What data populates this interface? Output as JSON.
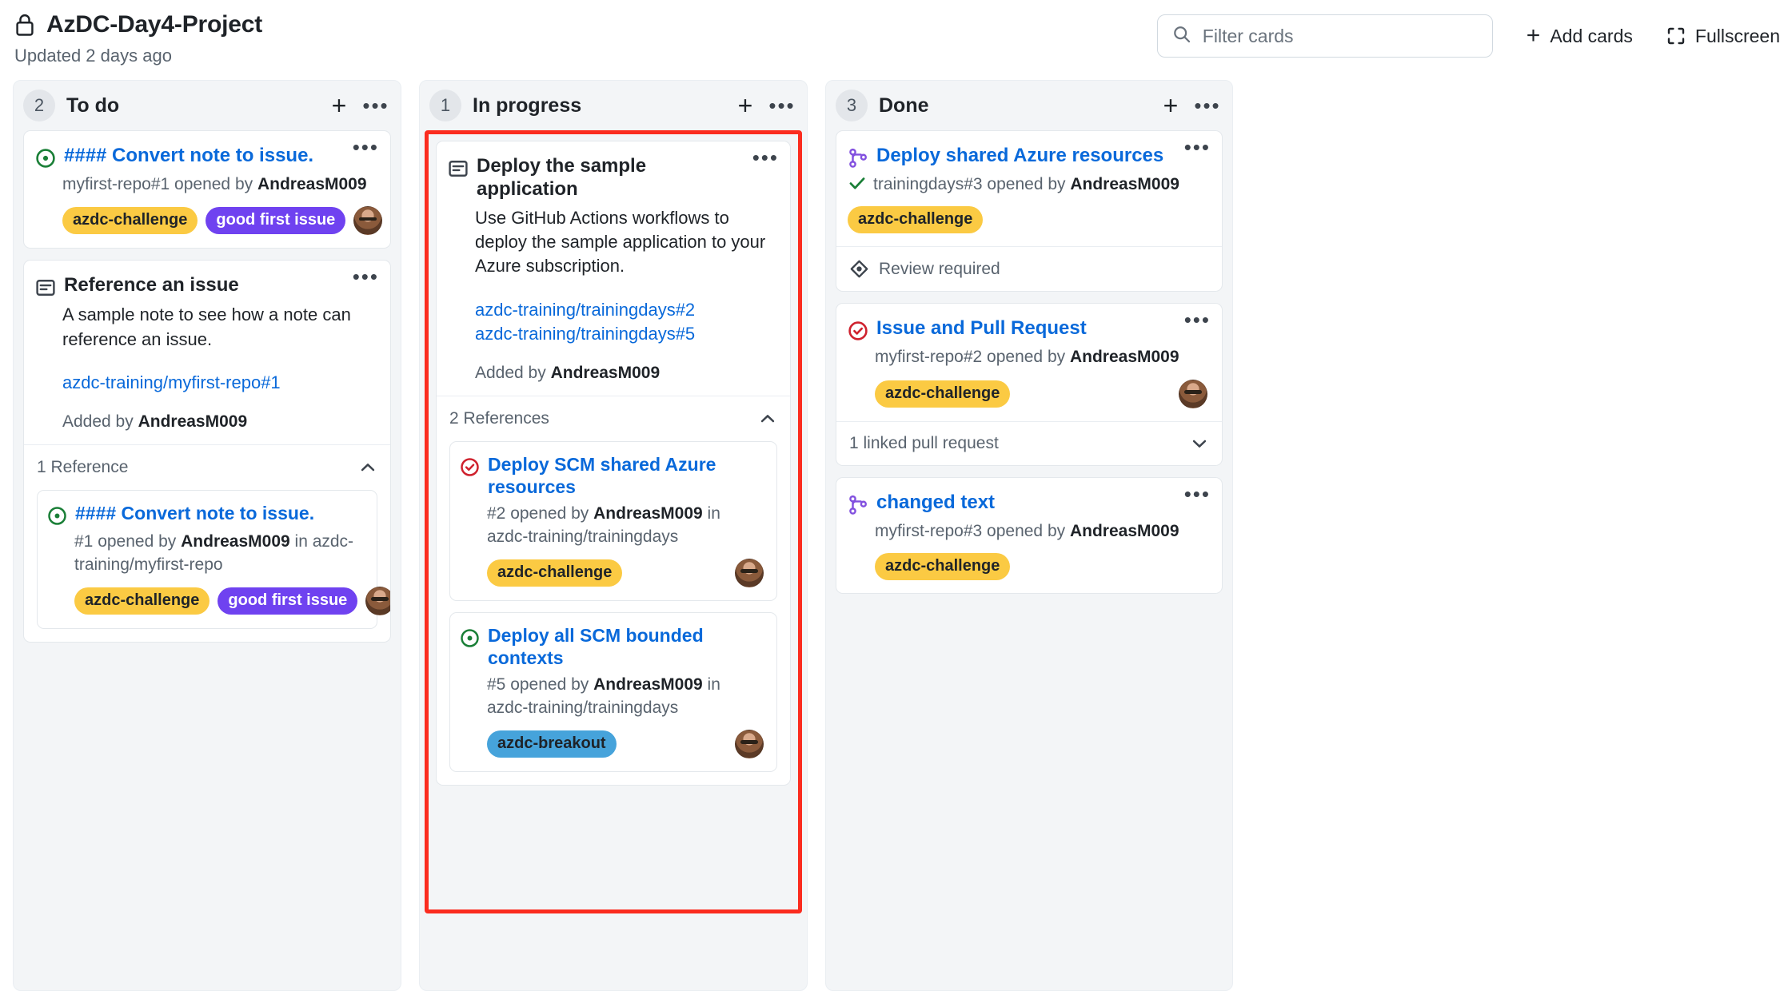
{
  "header": {
    "lock_icon": "lock-icon",
    "project_title": "AzDC-Day4-Project",
    "updated_text": "Updated 2 days ago",
    "search": {
      "icon": "search-icon",
      "placeholder": "Filter cards",
      "value": ""
    },
    "add_cards_label": "Add cards",
    "fullscreen_label": "Fullscreen"
  },
  "colors": {
    "label_azdc_challenge_bg": "#fbca43",
    "label_azdc_challenge_fg": "#1f2328",
    "label_good_first_issue_bg": "#6f42f0",
    "label_good_first_issue_fg": "#ffffff",
    "label_azdc_breakout_bg": "#46a3db",
    "label_azdc_breakout_fg": "#1f2328",
    "link": "#0969da",
    "highlight_border": "#fb2c1f",
    "issue_open": "#1a7f37",
    "issue_closed": "#cf222e",
    "pr_merged": "#8250df"
  },
  "columns": [
    {
      "name": "To do",
      "count": "2",
      "add_icon": "plus-icon",
      "menu_icon": "kebab-menu-icon",
      "highlighted": false,
      "cards": [
        {
          "kind": "issue",
          "icon": "issue-opened-icon",
          "title": "#### Convert note to issue.",
          "title_is_link": true,
          "meta_prefix": "myfirst-repo#1 opened by ",
          "meta_author": "AndreasM009",
          "labels": [
            {
              "text": "azdc-challenge",
              "style": "amber"
            },
            {
              "text": "good first issue",
              "style": "purple"
            }
          ],
          "has_avatar": true,
          "menu_icon": "kebab-menu-icon"
        },
        {
          "kind": "note",
          "icon": "note-icon",
          "title": "Reference an issue",
          "title_is_link": false,
          "body": "A sample note to see how a note can reference an issue.",
          "links": [
            "azdc-training/myfirst-repo#1"
          ],
          "added_prefix": "Added by ",
          "added_author": "AndreasM009",
          "menu_icon": "kebab-menu-icon",
          "references": {
            "label": "1 Reference",
            "chevron_icon": "chevron-up-icon",
            "items": [
              {
                "icon": "issue-opened-icon",
                "title": "#### Convert note to issue.",
                "meta_prefix": "#1 opened by ",
                "meta_author": "AndreasM009",
                "meta_suffix": " in azdc-training/myfirst-repo",
                "labels": [
                  {
                    "text": "azdc-challenge",
                    "style": "amber"
                  },
                  {
                    "text": "good first issue",
                    "style": "purple"
                  }
                ],
                "has_avatar": true
              }
            ]
          }
        }
      ]
    },
    {
      "name": "In progress",
      "count": "1",
      "add_icon": "plus-icon",
      "menu_icon": "kebab-menu-icon",
      "highlighted": true,
      "cards": [
        {
          "kind": "note",
          "icon": "note-icon",
          "title": "Deploy the sample application",
          "title_is_link": false,
          "body": "Use GitHub Actions workflows to deploy the sample application to your Azure subscription.",
          "links": [
            "azdc-training/trainingdays#2",
            "azdc-training/trainingdays#5"
          ],
          "added_prefix": "Added by ",
          "added_author": "AndreasM009",
          "menu_icon": "kebab-menu-icon",
          "references": {
            "label": "2 References",
            "chevron_icon": "chevron-up-icon",
            "items": [
              {
                "icon": "issue-closed-icon",
                "title": "Deploy SCM shared Azure resources",
                "meta_prefix": "#2 opened by ",
                "meta_author": "AndreasM009",
                "meta_suffix": " in azdc-training/trainingdays",
                "labels": [
                  {
                    "text": "azdc-challenge",
                    "style": "amber"
                  }
                ],
                "has_avatar": true
              },
              {
                "icon": "issue-opened-icon",
                "title": "Deploy all SCM bounded contexts",
                "meta_prefix": "#5 opened by ",
                "meta_author": "AndreasM009",
                "meta_suffix": " in azdc-training/trainingdays",
                "labels": [
                  {
                    "text": "azdc-breakout",
                    "style": "blue"
                  }
                ],
                "has_avatar": false
              }
            ]
          }
        }
      ]
    },
    {
      "name": "Done",
      "count": "3",
      "add_icon": "plus-icon",
      "menu_icon": "kebab-menu-icon",
      "highlighted": false,
      "cards": [
        {
          "kind": "pr",
          "icon": "git-merge-icon",
          "title": "Deploy shared Azure resources",
          "title_is_link": true,
          "status_icon": "check-icon",
          "meta_prefix": "trainingdays#3 opened by ",
          "meta_author": "AndreasM009",
          "labels": [
            {
              "text": "azdc-challenge",
              "style": "amber"
            }
          ],
          "has_avatar": false,
          "menu_icon": "kebab-menu-icon",
          "footer": {
            "icon": "review-required-icon",
            "text": "Review required",
            "chevron": ""
          }
        },
        {
          "kind": "issue",
          "icon": "issue-closed-icon",
          "title": "Issue and Pull Request",
          "title_is_link": true,
          "meta_prefix": "myfirst-repo#2 opened by ",
          "meta_author": "AndreasM009",
          "labels": [
            {
              "text": "azdc-challenge",
              "style": "amber"
            }
          ],
          "has_avatar": true,
          "menu_icon": "kebab-menu-icon",
          "footer": {
            "icon": "",
            "text": "1 linked pull request",
            "chevron": "chevron-down-icon"
          }
        },
        {
          "kind": "pr",
          "icon": "git-merge-icon",
          "title": "changed text",
          "title_is_link": true,
          "meta_prefix": "myfirst-repo#3 opened by ",
          "meta_author": "AndreasM009",
          "labels": [
            {
              "text": "azdc-challenge",
              "style": "amber"
            }
          ],
          "has_avatar": false,
          "menu_icon": "kebab-menu-icon"
        }
      ]
    }
  ]
}
